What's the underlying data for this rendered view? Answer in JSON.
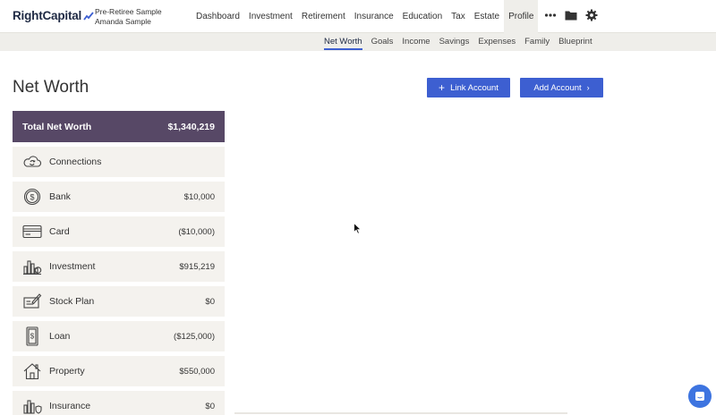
{
  "logo": {
    "text": "RightCapital"
  },
  "client": {
    "line1": "Pre-Retiree Sample",
    "line2": "Amanda Sample"
  },
  "nav": {
    "items": [
      "Dashboard",
      "Investment",
      "Retirement",
      "Insurance",
      "Education",
      "Tax",
      "Estate",
      "Profile"
    ],
    "active": "Profile",
    "icons": [
      "more-icon",
      "folder-icon",
      "gear-icon"
    ]
  },
  "subnav": {
    "items": [
      "Net Worth",
      "Goals",
      "Income",
      "Savings",
      "Expenses",
      "Family",
      "Blueprint"
    ],
    "active": "Net Worth"
  },
  "page": {
    "title": "Net Worth",
    "link_account": "Link Account",
    "add_account": "Add Account"
  },
  "summary": {
    "label": "Total Net Worth",
    "value": "$1,340,219"
  },
  "categories": [
    {
      "label": "Connections",
      "value": "",
      "icon": "cloud-sync-icon"
    },
    {
      "label": "Bank",
      "value": "$10,000",
      "icon": "dollar-coin-icon"
    },
    {
      "label": "Card",
      "value": "($10,000)",
      "icon": "credit-card-icon"
    },
    {
      "label": "Investment",
      "value": "$915,219",
      "icon": "investment-chart-icon"
    },
    {
      "label": "Stock Plan",
      "value": "$0",
      "icon": "stock-certificate-icon"
    },
    {
      "label": "Loan",
      "value": "($125,000)",
      "icon": "loan-document-icon"
    },
    {
      "label": "Property",
      "value": "$550,000",
      "icon": "house-icon"
    },
    {
      "label": "Insurance",
      "value": "$0",
      "icon": "insurance-icon"
    }
  ],
  "colors": {
    "accent": "#3d5fd1",
    "summary_bg": "#574866",
    "row_bg": "#f4f2ee",
    "subbar_bg": "#efeeea"
  }
}
